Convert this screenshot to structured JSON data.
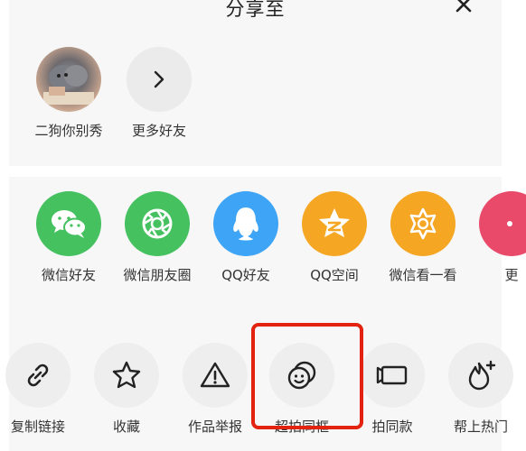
{
  "header": {
    "title": "分享至"
  },
  "friends": [
    {
      "name": "二狗你别秀"
    },
    {
      "name": "更多好友"
    }
  ],
  "share_apps": [
    {
      "label": "微信好友",
      "color": "#45c160",
      "icon": "wechat-icon"
    },
    {
      "label": "微信朋友圈",
      "color": "#45c160",
      "icon": "moments-icon"
    },
    {
      "label": "QQ好友",
      "color": "#3ea4f5",
      "icon": "qq-icon"
    },
    {
      "label": "QQ空间",
      "color": "#f5a623",
      "icon": "qzone-icon"
    },
    {
      "label": "微信看一看",
      "color": "#f5a623",
      "icon": "wechat-look-icon"
    },
    {
      "label": "更",
      "color": "#e94a6a",
      "icon": "more-app-icon"
    }
  ],
  "actions": [
    {
      "label": "复制链接",
      "icon": "link-icon"
    },
    {
      "label": "收藏",
      "icon": "star-icon"
    },
    {
      "label": "作品举报",
      "icon": "warning-icon"
    },
    {
      "label": "超拍同框",
      "icon": "duet-icon"
    },
    {
      "label": "拍同款",
      "icon": "camera-icon"
    },
    {
      "label": "帮上热门",
      "icon": "flame-icon"
    }
  ],
  "colors": {
    "highlight_border": "#e3230f",
    "sheet_bg": "#f7f7f7"
  }
}
